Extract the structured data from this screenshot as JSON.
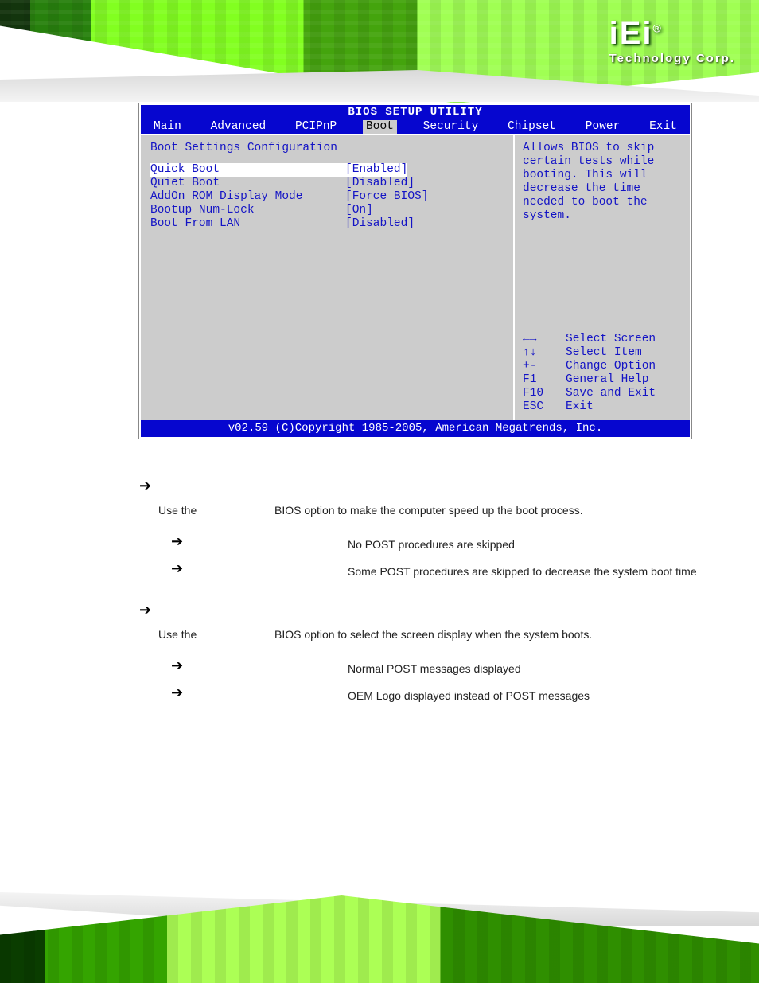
{
  "brand": {
    "logo_text": "iEi",
    "reg": "®",
    "tagline": "Technology Corp."
  },
  "bios": {
    "title": "BIOS SETUP UTILITY",
    "menu": [
      "Main",
      "Advanced",
      "PCIPnP",
      "Boot",
      "Security",
      "Chipset",
      "Power",
      "Exit"
    ],
    "menu_selected": "Boot",
    "panel_title": "Boot Settings Configuration",
    "rows": [
      {
        "label": "Quick Boot",
        "value": "[Enabled]",
        "selected": true
      },
      {
        "label": "Quiet Boot",
        "value": "[Disabled]"
      },
      {
        "label": "AddOn ROM Display Mode",
        "value": "[Force BIOS]"
      },
      {
        "label": "Bootup Num-Lock",
        "value": "[On]"
      },
      {
        "label": "Boot From LAN",
        "value": "[Disabled]"
      }
    ],
    "help_text": "Allows BIOS to skip certain tests while booting. This will decrease the time needed to boot the system.",
    "keys": [
      {
        "k": "←→",
        "d": "Select Screen"
      },
      {
        "k": "↑↓",
        "d": "Select Item"
      },
      {
        "k": "+-",
        "d": "Change Option"
      },
      {
        "k": "F1",
        "d": "General Help"
      },
      {
        "k": "F10",
        "d": "Save and Exit"
      },
      {
        "k": "ESC",
        "d": "Exit"
      }
    ],
    "footer": "v02.59 (C)Copyright 1985-2005, American Megatrends, Inc."
  },
  "doc": {
    "section1": {
      "para_pre": "Use the ",
      "para_post": " BIOS option to make the computer speed up the boot process.",
      "opts": [
        {
          "desc": "No POST procedures are skipped"
        },
        {
          "desc": "Some POST procedures are skipped to decrease the system boot time"
        }
      ]
    },
    "section2": {
      "para_pre": "Use the ",
      "para_post": " BIOS option to select the screen display when the system boots.",
      "opts": [
        {
          "desc": "Normal POST messages displayed"
        },
        {
          "desc": "OEM Logo displayed instead of POST messages"
        }
      ]
    }
  }
}
